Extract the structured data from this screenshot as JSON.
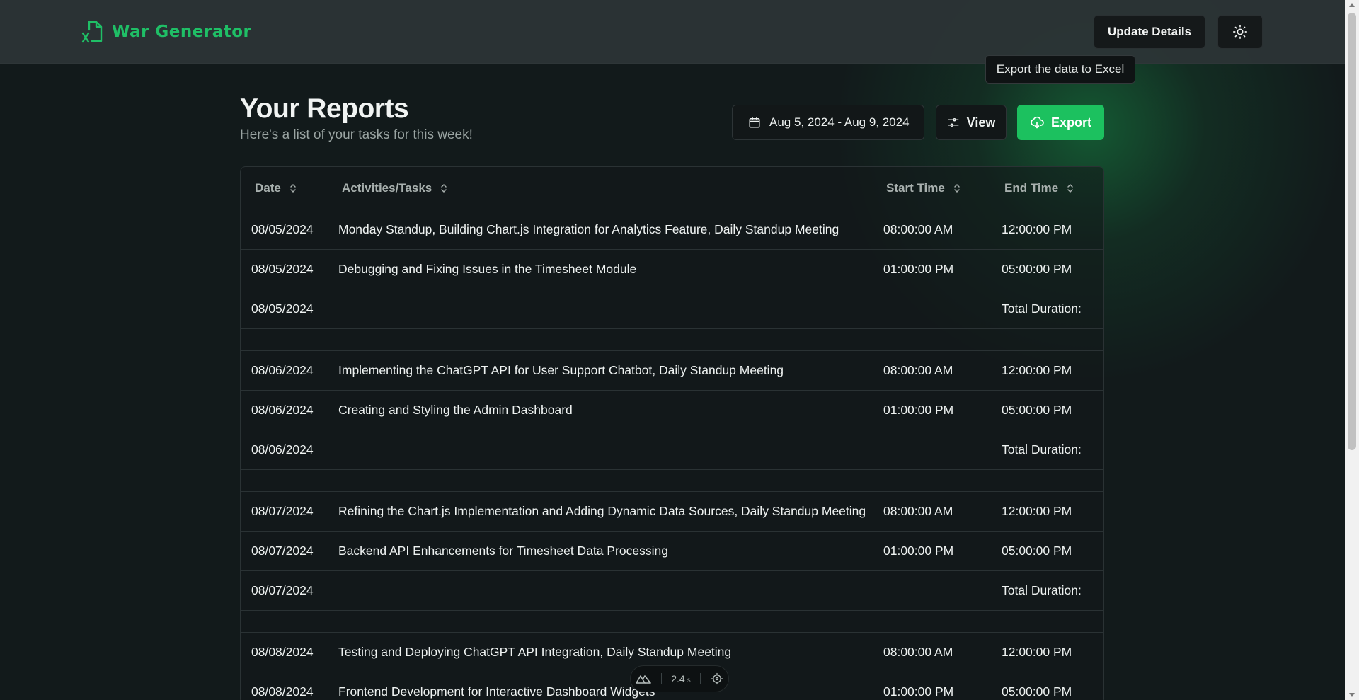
{
  "app": {
    "brand": "War Generator",
    "update_label": "Update Details",
    "tooltip": "Export the data to Excel",
    "accent_color": "#1cc15f"
  },
  "header": {
    "title": "Your Reports",
    "subtitle": "Here's a list of your tasks for this week!",
    "date_range": "Aug 5, 2024 - Aug 9, 2024",
    "view_label": "View",
    "export_label": "Export"
  },
  "table": {
    "columns": [
      "Date",
      "Activities/Tasks",
      "Start Time",
      "End Time"
    ],
    "rows": [
      {
        "date": "08/05/2024",
        "task": "Monday Standup, Building Chart.js Integration for Analytics Feature, Daily Standup Meeting",
        "start": "08:00:00 AM",
        "end": "12:00:00 PM"
      },
      {
        "date": "08/05/2024",
        "task": "Debugging and Fixing Issues in the Timesheet Module",
        "start": "01:00:00 PM",
        "end": "05:00:00 PM"
      },
      {
        "date": "08/05/2024",
        "task": "",
        "start": "",
        "end": "Total Duration:"
      },
      {
        "spacer": true
      },
      {
        "date": "08/06/2024",
        "task": "Implementing the ChatGPT API for User Support Chatbot, Daily Standup Meeting",
        "start": "08:00:00 AM",
        "end": "12:00:00 PM"
      },
      {
        "date": "08/06/2024",
        "task": "Creating and Styling the Admin Dashboard",
        "start": "01:00:00 PM",
        "end": "05:00:00 PM"
      },
      {
        "date": "08/06/2024",
        "task": "",
        "start": "",
        "end": "Total Duration:"
      },
      {
        "spacer": true
      },
      {
        "date": "08/07/2024",
        "task": "Refining the Chart.js Implementation and Adding Dynamic Data Sources, Daily Standup Meeting",
        "start": "08:00:00 AM",
        "end": "12:00:00 PM"
      },
      {
        "date": "08/07/2024",
        "task": "Backend API Enhancements for Timesheet Data Processing",
        "start": "01:00:00 PM",
        "end": "05:00:00 PM"
      },
      {
        "date": "08/07/2024",
        "task": "",
        "start": "",
        "end": "Total Duration:"
      },
      {
        "spacer": true
      },
      {
        "date": "08/08/2024",
        "task": "Testing and Deploying ChatGPT API Integration, Daily Standup Meeting",
        "start": "08:00:00 AM",
        "end": "12:00:00 PM"
      },
      {
        "date": "08/08/2024",
        "task": "Frontend Development for Interactive Dashboard Widgets",
        "start": "01:00:00 PM",
        "end": "05:00:00 PM"
      }
    ]
  },
  "devtools": {
    "time_value": "2.4",
    "time_unit": "s"
  },
  "icons": {
    "logo": "excel-file-icon",
    "theme": "sun-icon",
    "date": "calendar-icon",
    "view": "sliders-icon",
    "export": "cloud-download-icon",
    "sort": "sort-icon"
  }
}
